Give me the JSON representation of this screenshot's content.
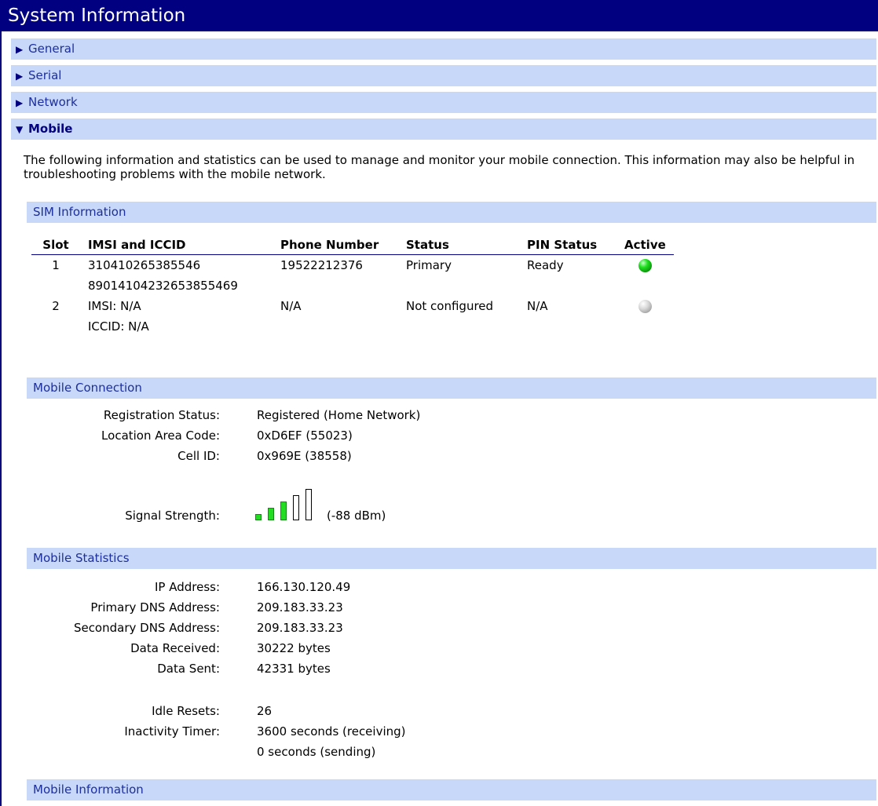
{
  "title": "System Information",
  "accordion": [
    {
      "label": "General",
      "state": "collapsed"
    },
    {
      "label": "Serial",
      "state": "collapsed"
    },
    {
      "label": "Network",
      "state": "collapsed"
    },
    {
      "label": "Mobile",
      "state": "expanded"
    }
  ],
  "intro": "The following information and statistics can be used to manage and monitor your mobile connection. This information may also be helpful in troubleshooting problems with the mobile network.",
  "sim": {
    "heading": "SIM Information",
    "columns": [
      "Slot",
      "IMSI and ICCID",
      "Phone Number",
      "Status",
      "PIN Status",
      "Active"
    ],
    "rows": [
      {
        "slot": "1",
        "imsi": "310410265385546",
        "iccid": "89014104232653855469",
        "phone": "19522212376",
        "status": "Primary",
        "pin": "Ready",
        "active": "green"
      },
      {
        "slot": "2",
        "imsi": "IMSI: N/A",
        "iccid": "ICCID: N/A",
        "phone": "N/A",
        "status": "Not configured",
        "pin": "N/A",
        "active": "gray"
      }
    ]
  },
  "connection": {
    "heading": "Mobile Connection",
    "registration_label": "Registration Status:",
    "registration_value": "Registered (Home Network)",
    "lac_label": "Location Area Code:",
    "lac_value": "0xD6EF  (55023)",
    "cellid_label": "Cell ID:",
    "cellid_value": "0x969E  (38558)",
    "signal_label": "Signal Strength:",
    "signal_value": "(-88 dBm)",
    "signal_bars_lit": 3,
    "signal_bars_total": 5,
    "bar_on_color": "#22dd22"
  },
  "statistics": {
    "heading": "Mobile Statistics",
    "ip_label": "IP Address:",
    "ip_value": "166.130.120.49",
    "pdns_label": "Primary DNS Address:",
    "pdns_value": "209.183.33.23",
    "sdns_label": "Secondary DNS Address:",
    "sdns_value": "209.183.33.23",
    "rx_label": "Data Received:",
    "rx_value": "30222 bytes",
    "tx_label": "Data Sent:",
    "tx_value": "42331 bytes",
    "idle_label": "Idle Resets:",
    "idle_value": "26",
    "timer_label": "Inactivity Timer:",
    "timer_value_rx": "3600 seconds (receiving)",
    "timer_value_tx": "0 seconds (sending)"
  },
  "information": {
    "heading": "Mobile Information"
  }
}
